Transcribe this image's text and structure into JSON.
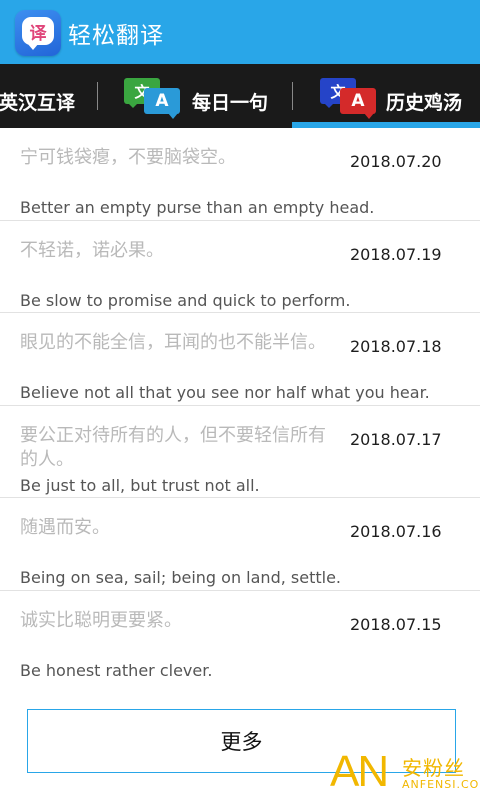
{
  "app": {
    "title": "轻松翻译",
    "icon_glyph": "译",
    "header_color": "#29a6e8"
  },
  "tabs": [
    {
      "label": "英汉互译",
      "icon": "none",
      "selected": false
    },
    {
      "label": "每日一句",
      "icon": "translate-icon",
      "icon_back_glyph": "文",
      "icon_front_glyph": "A",
      "selected": false
    },
    {
      "label": "历史鸡汤",
      "icon": "translate-icon",
      "icon_back_glyph": "文",
      "icon_front_glyph": "A",
      "selected": true
    }
  ],
  "items": [
    {
      "cn": "宁可钱袋瘪，不要脑袋空。",
      "date": "2018.07.20",
      "en": "Better an empty purse than an empty head."
    },
    {
      "cn": "不轻诺，诺必果。",
      "date": "2018.07.19",
      "en": "Be slow to promise and quick to perform."
    },
    {
      "cn": "眼见的不能全信，耳闻的也不能半信。",
      "date": "2018.07.18",
      "en": "Believe not all that you see nor half what you hear."
    },
    {
      "cn": "要公正对待所有的人，但不要轻信所有的人。",
      "date": "2018.07.17",
      "en": "Be just to all, but trust not all."
    },
    {
      "cn": "随遇而安。",
      "date": "2018.07.16",
      "en": "Being on sea, sail; being on land, settle."
    },
    {
      "cn": "诚实比聪明更要紧。",
      "date": "2018.07.15",
      "en": "Be honest rather clever."
    }
  ],
  "more_button": {
    "label": "更多"
  },
  "watermark": {
    "logo": "AN",
    "cn": "安粉丝",
    "en": "ANFENSI.COM"
  }
}
